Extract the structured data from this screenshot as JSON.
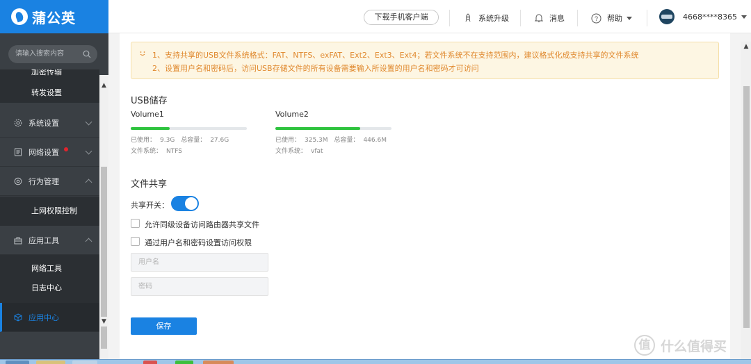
{
  "app": {
    "logo_text": "蒲公英"
  },
  "header": {
    "download_label": "下载手机客户端",
    "upgrade_label": "系统升级",
    "message_label": "消息",
    "help_label": "帮助",
    "account": "4668****8365"
  },
  "sidebar": {
    "search_placeholder": "请输入搜索内容",
    "cut_item": "加密传输",
    "forward": "转发设置",
    "system": "系统设置",
    "network": "网络设置",
    "behavior": "行为管理",
    "access": "上网权限控制",
    "tools": "应用工具",
    "nettools": "网络工具",
    "logs": "日志中心",
    "appcenter": "应用中心"
  },
  "notice": {
    "line1": "1、支持共享的USB文件系统格式：FAT、NTFS、exFAT、Ext2、Ext3、Ext4；若文件系统不在支持范围内，建议格式化成支持共享的文件系统",
    "line2": "2、设置用户名和密码后，访问USB存储文件的所有设备需要输入所设置的用户名和密码才可访问"
  },
  "usb": {
    "title": "USB储存",
    "volumes": [
      {
        "name": "Volume1",
        "used_label": "已使用：",
        "used": "9.3G",
        "total_label": "总容量：",
        "total": "27.6G",
        "fs_label": "文件系统：",
        "fs": "NTFS",
        "usage_fraction": 0.337
      },
      {
        "name": "Volume2",
        "used_label": "已使用：",
        "used": "325.3M",
        "total_label": "总容量：",
        "total": "446.6M",
        "fs_label": "文件系统：",
        "fs": "vfat",
        "usage_fraction": 0.728
      }
    ]
  },
  "share": {
    "title": "文件共享",
    "toggle_label": "共享开关：",
    "toggle_on": true,
    "option1": "允许同级设备访问路由器共享文件",
    "option2": "通过用户名和密码设置访问权限",
    "username_placeholder": "用户名",
    "password_placeholder": "密码",
    "save_label": "保存"
  },
  "watermark": {
    "circle": "值",
    "text": "什么值得买"
  },
  "colors": {
    "brand": "#1a82e2",
    "sidebar": "#3a3f44",
    "usage": "#2ec33e",
    "notice_text": "#e0882d"
  }
}
